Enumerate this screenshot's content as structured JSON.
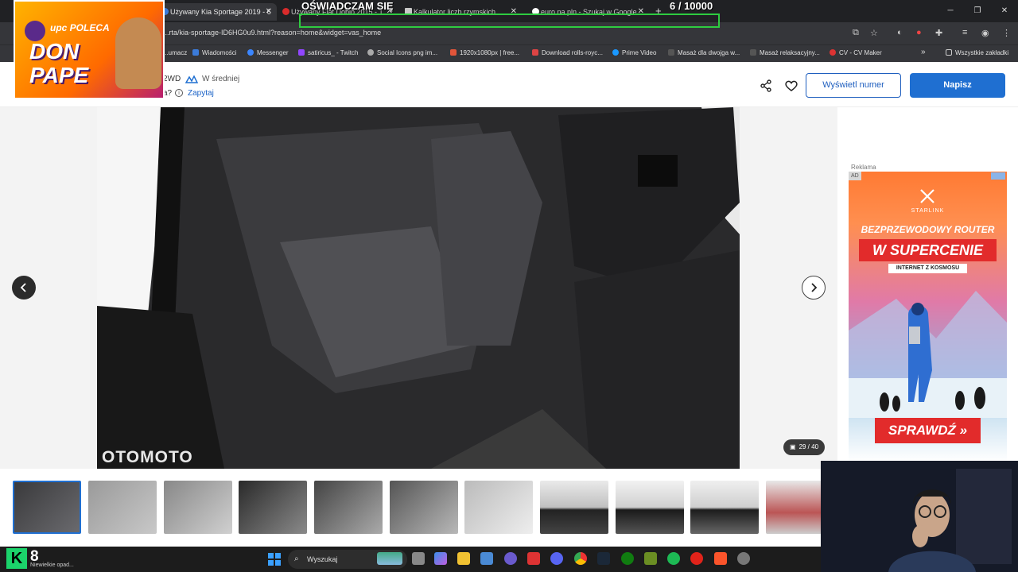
{
  "browser": {
    "tabs": [
      {
        "label": "Używany Kia Sportage 2019 - 6",
        "active": true
      },
      {
        "label": "Używany Fiat Doblo 2015 - 1",
        "active": false
      },
      {
        "label": "Kalkulator liczb rzymskich",
        "active": false
      },
      {
        "label": "euro na pln - Szukaj w Google",
        "active": false
      }
    ],
    "new_tab": "+",
    "url": "...rta/kia-sportage-ID6HG0u9.html?reason=home&widget=vas_home",
    "bookmarks": [
      "...umacz",
      "Wiadomości",
      "Messenger",
      "satiricus_ - Twitch",
      "Social Icons png im...",
      "1920x1080px | free...",
      "Download rolls-royc...",
      "Prime Video",
      "Masaż dla dwojga w...",
      "Masaż relaksacyjny...",
      "CV - CV Maker"
    ],
    "bookmarks_folder": "Wszystkie zakładki"
  },
  "stream": {
    "logo_line1": "upc POLECA",
    "logo_line2": "DON PAPE",
    "counter_label": "OŚWIADCZAM SIĘ",
    "counter_value": "6  / 10000"
  },
  "listing": {
    "spec": "2WD",
    "price_eval": "W średniej",
    "ask_prefix": "a?",
    "ask_link": "Zapytaj",
    "btn_phone": "Wyświetl numer",
    "btn_write": "Napisz"
  },
  "gallery": {
    "watermark": "OTOMOTO",
    "counter": "29 / 40",
    "thumbnails": 11
  },
  "ad": {
    "label": "Reklama",
    "tag": "AD",
    "brand": "STARLINK",
    "headline1": "BEZPRZEWODOWY ROUTER",
    "headline2": "W SUPERCENIE",
    "sub": "INTERNET Z KOSMOSU",
    "cta": "SPRAWDŹ »"
  },
  "taskbar": {
    "weather_temp": "8",
    "weather_desc": "Niewielkie opad...",
    "weather_badge": "K",
    "search": "Wyszukaj"
  },
  "colors": {
    "accent": "#1f6fd1",
    "counter_border": "#2ecc40",
    "ad_red": "#e22b2b"
  }
}
